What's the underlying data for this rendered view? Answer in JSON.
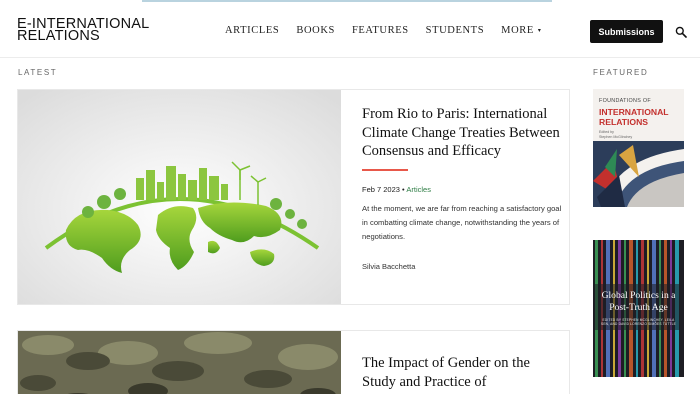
{
  "site": {
    "logo_line1": "E-INTERNATIONAL",
    "logo_line2": "RELATIONS"
  },
  "nav": {
    "items": [
      "ARTICLES",
      "BOOKS",
      "FEATURES",
      "STUDENTS",
      "MORE"
    ],
    "more_caret": "▾"
  },
  "header": {
    "submit_label": "Submissions",
    "search_icon": "search-icon"
  },
  "sections": {
    "latest": "LATEST",
    "featured": "FEATURED"
  },
  "articles": [
    {
      "title": "From Rio to Paris: International Climate Change Treaties Between Consensus and Efficacy",
      "date": "Feb 7 2023",
      "separator": "•",
      "category": "Articles",
      "excerpt": "At the moment, we are far from reaching a satisfactory goal in combatting climate change, notwithstanding the years of negotiations.",
      "author": "Silvia Bacchetta"
    },
    {
      "title": "The Impact of Gender on the Study and Practice of"
    }
  ],
  "featured": [
    {
      "top": "FOUNDATIONS OF",
      "main": "INTERNATIONAL RELATIONS",
      "editor_line1": "Edited by",
      "editor_line2": "Stephen McGlinchey"
    },
    {
      "title": "Global Politics in a Post-Truth Age",
      "subtitle": "EDITED BY STEPHEN MCGLINCHEY, LEILA SEN, AND DAVID LORENZO SIMÕES TUTTLE"
    }
  ],
  "colors": {
    "accent_rule": "#e8584a",
    "category_green": "#2f7d45",
    "submit_bg": "#111111",
    "book1_title": "#c3302d"
  }
}
